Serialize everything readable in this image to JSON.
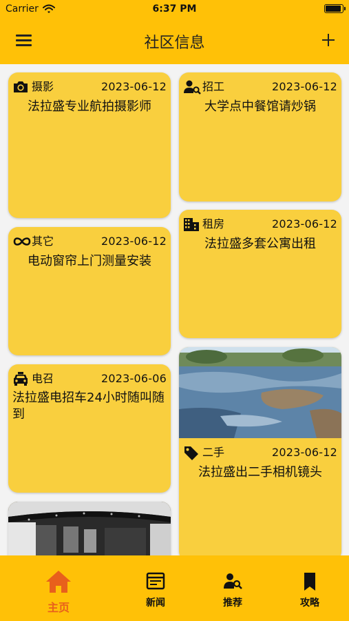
{
  "status_bar": {
    "carrier": "Carrier",
    "time": "6:37 PM"
  },
  "header": {
    "title": "社区信息",
    "menu_icon": "hamburger-menu-icon",
    "add_icon": "plus-icon"
  },
  "colors": {
    "accent": "#FFC107",
    "card": "#F9CF3E",
    "active_tab": "#E8601C"
  },
  "posts": [
    {
      "category": "摄影",
      "icon": "camera-icon",
      "date": "2023-06-12",
      "title": "法拉盛专业航拍摄影师"
    },
    {
      "category": "招工",
      "icon": "person-search-icon",
      "date": "2023-06-12",
      "title": "大学点中餐馆请炒锅"
    },
    {
      "category": "其它",
      "icon": "infinity-icon",
      "date": "2023-06-12",
      "title": "电动窗帘上门测量安装"
    },
    {
      "category": "租房",
      "icon": "building-icon",
      "date": "2023-06-12",
      "title": "法拉盛多套公寓出租"
    },
    {
      "category": "电召",
      "icon": "taxi-icon",
      "date": "2023-06-06",
      "title": "法拉盛电招车24小时随叫随到"
    },
    {
      "category": "二手",
      "icon": "tag-icon",
      "date": "2023-06-12",
      "title": "法拉盛出二手相机镜头"
    }
  ],
  "tabs": [
    {
      "label": "主页",
      "icon": "home-icon",
      "active": true
    },
    {
      "label": "新闻",
      "icon": "news-icon",
      "active": false
    },
    {
      "label": "推荐",
      "icon": "person-search-icon",
      "active": false
    },
    {
      "label": "攻略",
      "icon": "bookmark-icon",
      "active": false
    }
  ]
}
